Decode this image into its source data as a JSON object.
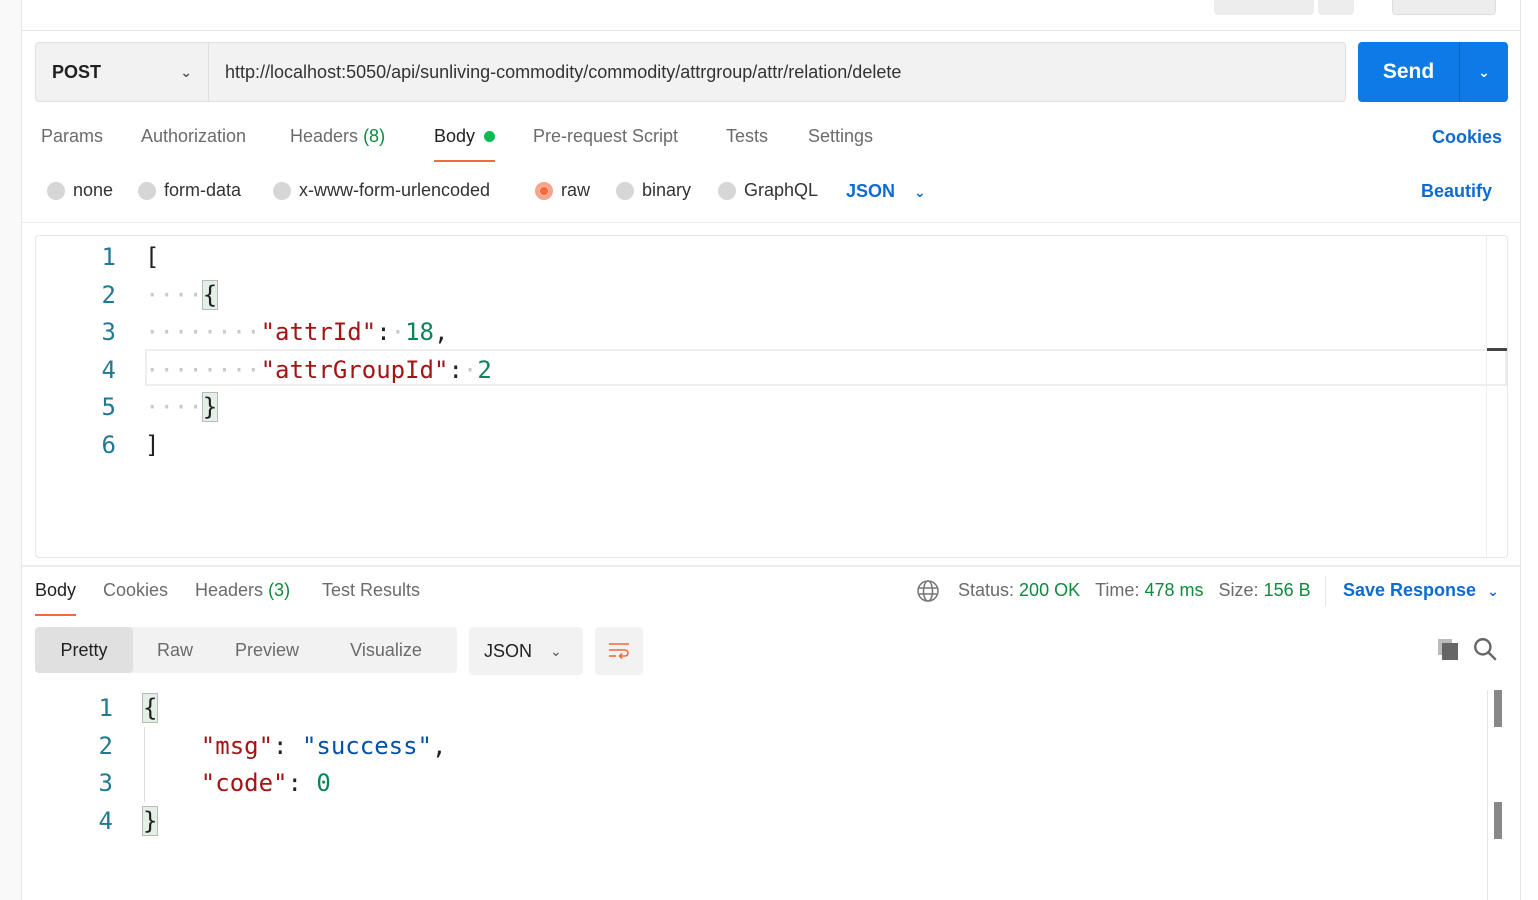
{
  "request": {
    "method": "POST",
    "url": "http://localhost:5050/api/sunliving-commodity/commodity/attrgroup/attr/relation/delete",
    "send_label": "Send"
  },
  "tabs": [
    {
      "label": "Params"
    },
    {
      "label": "Authorization"
    },
    {
      "label": "Headers",
      "count": "(8)"
    },
    {
      "label": "Body"
    },
    {
      "label": "Pre-request Script"
    },
    {
      "label": "Tests"
    },
    {
      "label": "Settings"
    }
  ],
  "cookies_label": "Cookies",
  "body_types": [
    "none",
    "form-data",
    "x-www-form-urlencoded",
    "raw",
    "binary",
    "GraphQL"
  ],
  "body_selected": "raw",
  "body_language": "JSON",
  "beautify_label": "Beautify",
  "request_body_lines": [
    "1",
    "2",
    "3",
    "4",
    "5",
    "6"
  ],
  "request_body": {
    "key1": "\"attrId\"",
    "val1": "18",
    "key2": "\"attrGroupId\"",
    "val2": "2"
  },
  "response": {
    "tabs": [
      {
        "label": "Body"
      },
      {
        "label": "Cookies"
      },
      {
        "label": "Headers",
        "count": "(3)"
      },
      {
        "label": "Test Results"
      }
    ],
    "status_label": "Status:",
    "status": "200 OK",
    "time_label": "Time:",
    "time": "478 ms",
    "size_label": "Size:",
    "size": "156 B",
    "save_label": "Save Response",
    "views": [
      "Pretty",
      "Raw",
      "Preview",
      "Visualize"
    ],
    "format": "JSON",
    "lines": [
      "1",
      "2",
      "3",
      "4"
    ],
    "body": {
      "key1": "\"msg\"",
      "val1": "\"success\"",
      "key2": "\"code\"",
      "val2": "0"
    }
  },
  "colors": {
    "accent": "#0d7ae8",
    "active_tab": "#f26b3a",
    "success": "#0f8a3c"
  }
}
